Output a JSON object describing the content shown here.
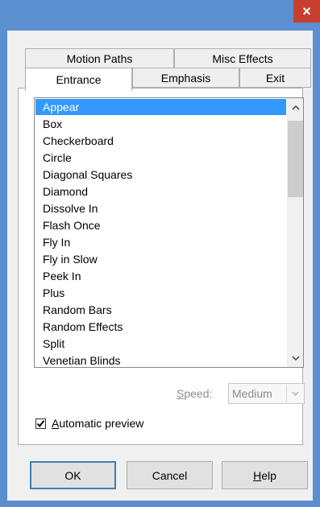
{
  "window": {
    "close_glyph": "×"
  },
  "tabs": {
    "row1": [
      "Motion Paths",
      "Misc Effects"
    ],
    "row2": [
      "Entrance",
      "Emphasis",
      "Exit"
    ],
    "active": "Entrance"
  },
  "effects_list": {
    "items": [
      "Appear",
      "Box",
      "Checkerboard",
      "Circle",
      "Diagonal Squares",
      "Diamond",
      "Dissolve In",
      "Flash Once",
      "Fly In",
      "Fly in Slow",
      "Peek In",
      "Plus",
      "Random Bars",
      "Random Effects",
      "Split",
      "Venetian Blinds"
    ],
    "selected": "Appear"
  },
  "speed": {
    "label_prefix": "",
    "label_underlined": "S",
    "label_rest": "peed:",
    "value": "Medium"
  },
  "automatic_preview": {
    "checked": true,
    "label_underlined": "A",
    "label_rest": "utomatic preview"
  },
  "buttons": {
    "ok": "OK",
    "cancel": "Cancel",
    "help_underlined": "H",
    "help_rest": "elp"
  }
}
